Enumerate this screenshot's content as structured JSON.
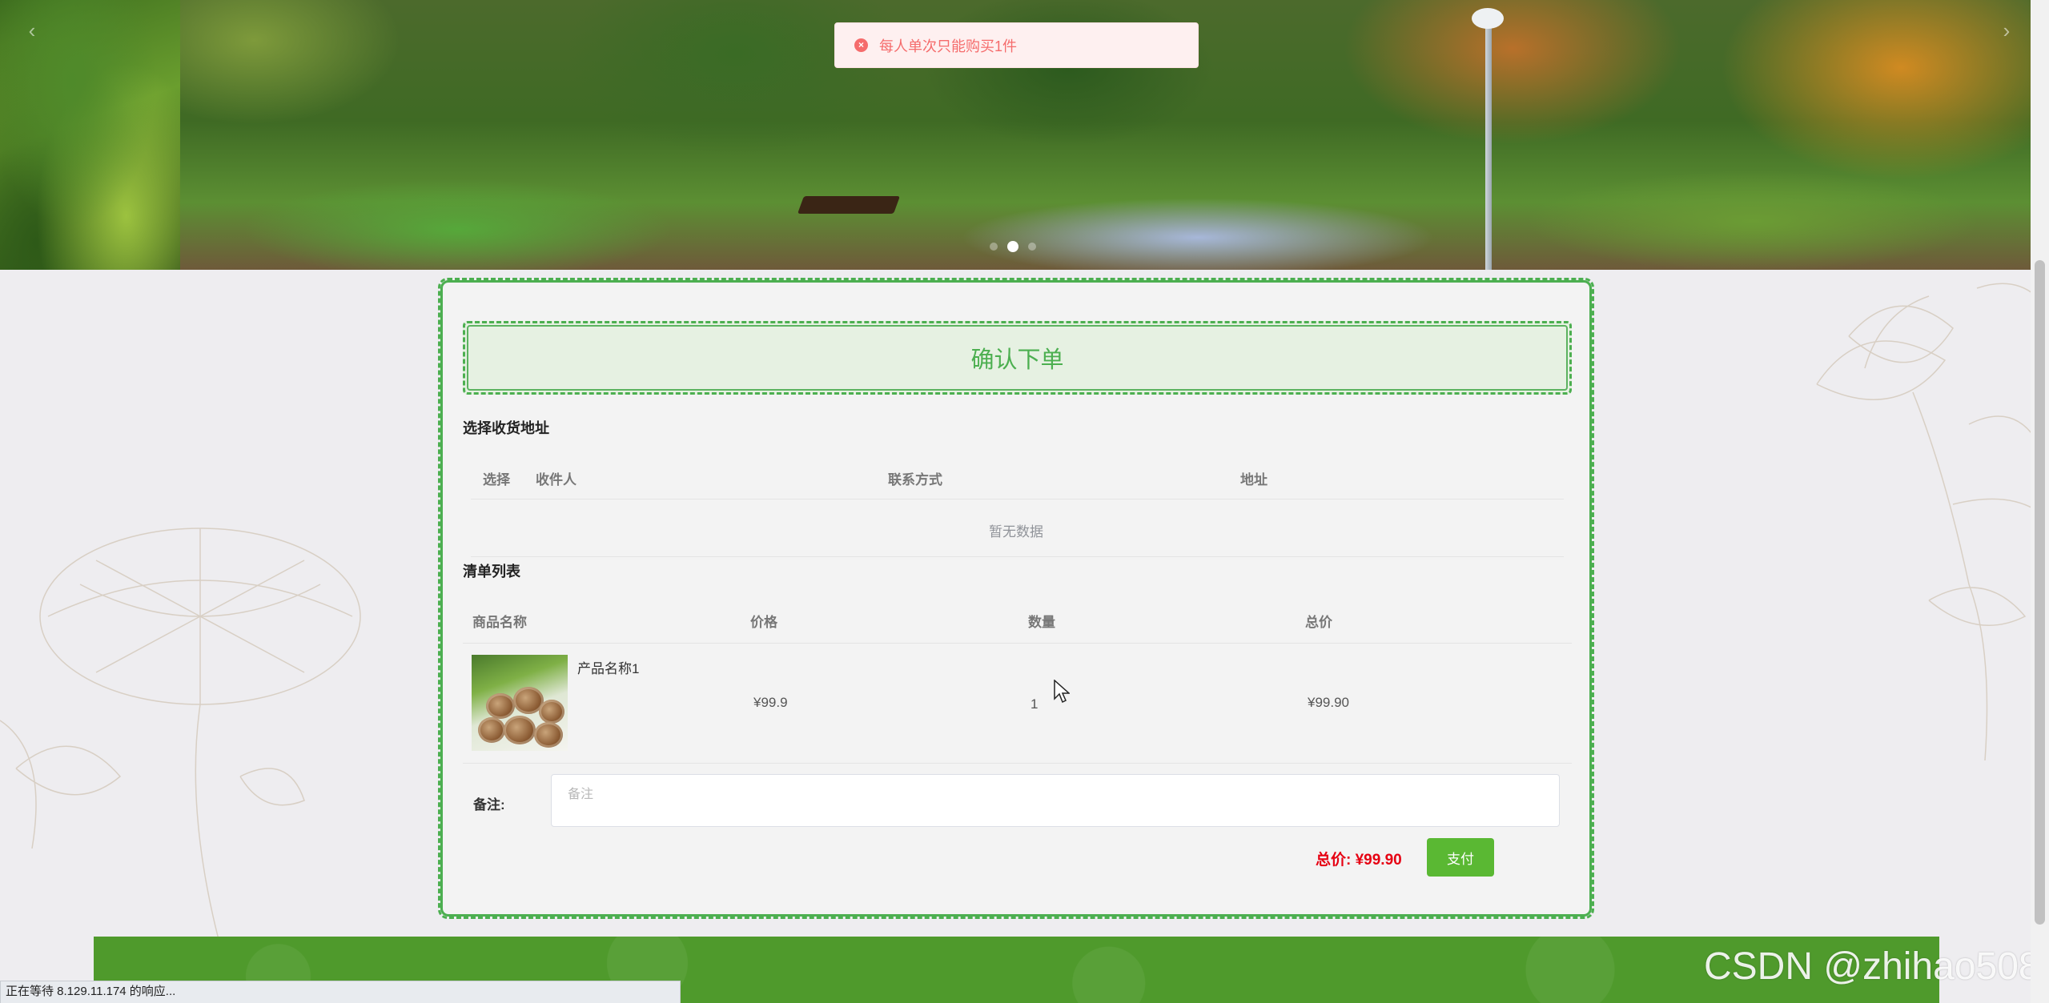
{
  "toast": {
    "message": "每人单次只能购买1件",
    "type": "error",
    "icon": "close-circle-icon"
  },
  "carousel": {
    "dot_count": 3,
    "active_index": 1
  },
  "order": {
    "title": "确认下单",
    "address_section": {
      "title": "选择收货地址",
      "columns": [
        "选择",
        "收件人",
        "联系方式",
        "地址"
      ],
      "empty_text": "暂无数据"
    },
    "items_section": {
      "title": "清单列表",
      "columns": [
        "商品名称",
        "价格",
        "数量",
        "总价"
      ],
      "rows": [
        {
          "name": "产品名称1",
          "price": "¥99.9",
          "quantity": "1",
          "total": "¥99.90"
        }
      ]
    },
    "remark": {
      "label": "备注:",
      "placeholder": "备注",
      "value": ""
    },
    "total_label": "总价:  ¥99.90",
    "pay_label": "支付"
  },
  "watermark": "CSDN @zhihao508",
  "status_bar": "正在等待 8.129.11.174 的响应...",
  "colors": {
    "accent": "#4caf50",
    "pay_button": "#5ab833",
    "total_price": "#e60012",
    "toast_error": "#f56c6c",
    "footer": "#4f9a2c"
  }
}
